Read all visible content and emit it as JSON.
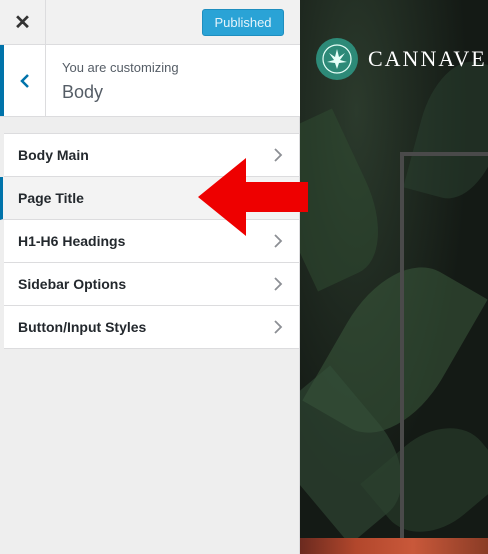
{
  "topbar": {
    "close_icon": "close-icon",
    "published_label": "Published"
  },
  "section": {
    "customizing_label": "You are customizing",
    "title": "Body",
    "back_icon": "chevron-left-icon"
  },
  "menu": {
    "items": [
      {
        "label": "Body Main",
        "active": false
      },
      {
        "label": "Page Title",
        "active": true
      },
      {
        "label": "H1-H6 Headings",
        "active": false
      },
      {
        "label": "Sidebar Options",
        "active": false
      },
      {
        "label": "Button/Input Styles",
        "active": false
      }
    ]
  },
  "preview": {
    "brand_name": "CANNAVE"
  },
  "colors": {
    "accent": "#0073aa",
    "published_bg": "#2aa3d6",
    "brand_logo": "#2d8a78",
    "annotation_arrow": "#ee0000"
  }
}
